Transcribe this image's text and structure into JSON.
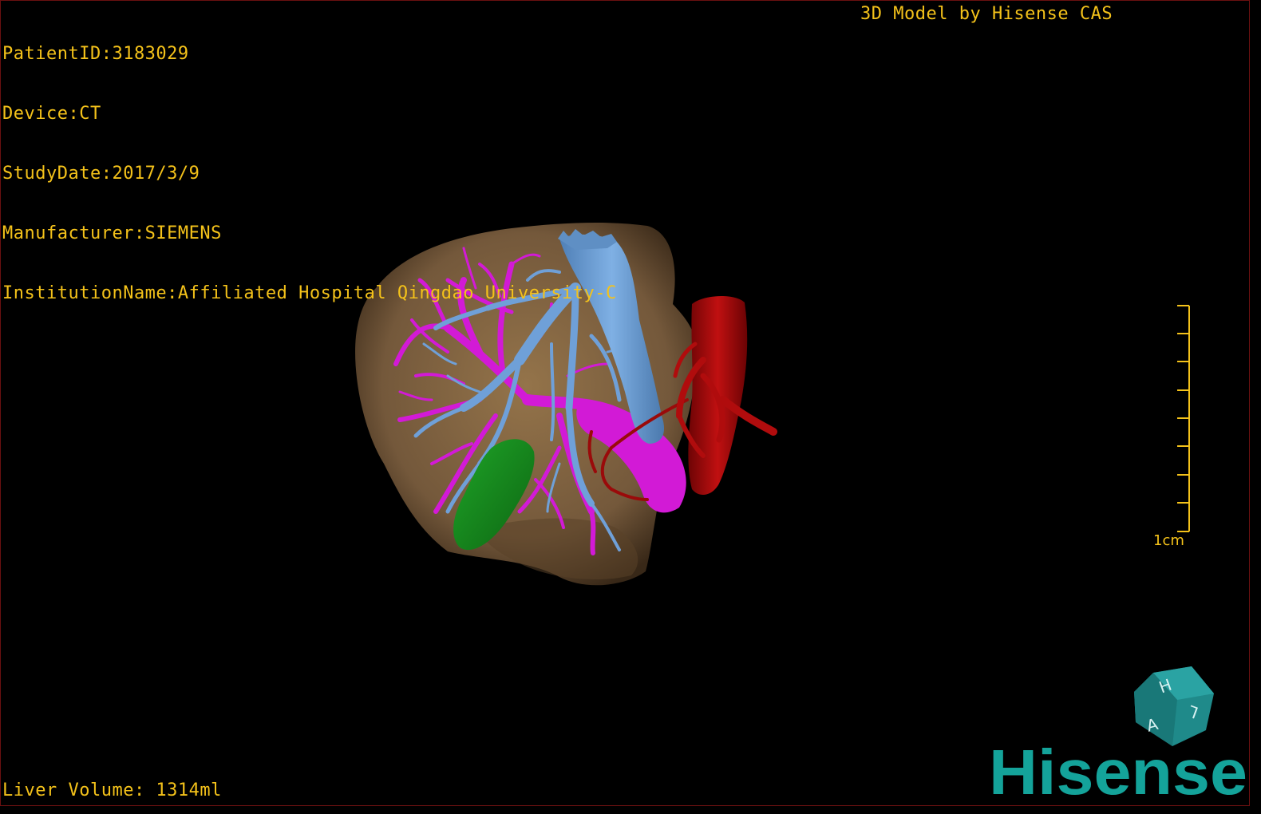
{
  "overlay": {
    "patient_id": "PatientID:3183029",
    "device": "Device:CT",
    "study_date": "StudyDate:2017/3/9",
    "manufacturer": "Manufacturer:SIEMENS",
    "institution": "InstitutionName:Affiliated Hospital Qingdao University-C",
    "brand_caption": "3D Model by Hisense CAS",
    "liver_volume": "Liver Volume: 1314ml",
    "text_color": "#f4c21a"
  },
  "scale": {
    "label": "1cm",
    "ticks": 9
  },
  "orientation_cube": {
    "letters": [
      "H",
      "A",
      "L"
    ],
    "color": "#1f8a8a"
  },
  "logo": {
    "text": "Hisense",
    "color": "#14a39a"
  },
  "model": {
    "structures": [
      {
        "name": "liver",
        "color": "#8a6a43"
      },
      {
        "name": "hepatic-veins",
        "color": "#6fa0d8"
      },
      {
        "name": "portal-veins",
        "color": "#d21ad6"
      },
      {
        "name": "gallbladder",
        "color": "#168a1c"
      },
      {
        "name": "aorta",
        "color": "#a8090a"
      }
    ]
  }
}
